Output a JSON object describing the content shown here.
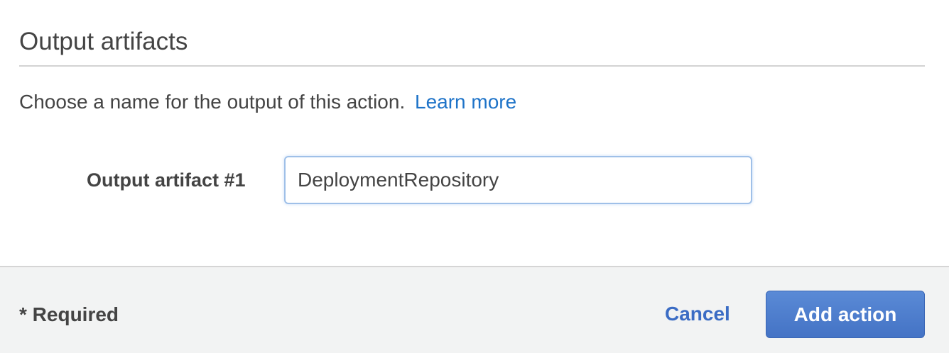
{
  "section": {
    "title": "Output artifacts",
    "description": "Choose a name for the output of this action.",
    "learn_more_label": "Learn more"
  },
  "form": {
    "output_artifact_label": "Output artifact #1",
    "output_artifact_value": "DeploymentRepository"
  },
  "footer": {
    "required_note": "* Required",
    "cancel_label": "Cancel",
    "add_action_label": "Add action"
  },
  "colors": {
    "link": "#1e73c8",
    "primary_button": "#4473c5",
    "input_focus_border": "#9fc0e8",
    "footer_background": "#f2f3f3"
  }
}
